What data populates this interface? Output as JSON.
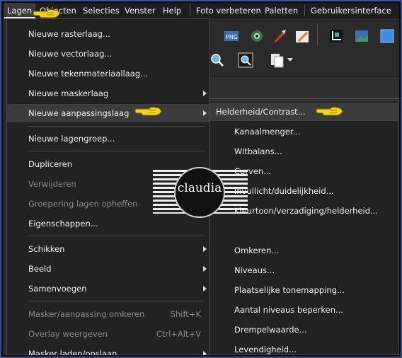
{
  "menubar": {
    "items": [
      "Lagen",
      "Objecten",
      "Selecties",
      "Venster",
      "Help",
      "Foto verbeteren",
      "Paletten",
      "Gebruikersinterface"
    ]
  },
  "layers_menu": {
    "items": [
      {
        "label": "Nieuwe rasterlaag...",
        "submenu": false
      },
      {
        "label": "Nieuwe vectorlaag...",
        "submenu": false
      },
      {
        "label": "Nieuwe tekenmateriaallaag...",
        "submenu": false
      },
      {
        "label": "Nieuwe maskerlaag",
        "submenu": true
      },
      {
        "label": "Nieuwe aanpassingslaag",
        "submenu": true,
        "highlighted": true
      },
      {
        "label": "Nieuwe lagengroep...",
        "submenu": false
      },
      {
        "label": "Dupliceren",
        "submenu": false
      },
      {
        "label": "Verwijderen",
        "disabled": true
      },
      {
        "label": "Groepering lagen opheffen",
        "disabled": true
      },
      {
        "label": "Eigenschappen...",
        "submenu": false
      },
      {
        "label": "Schikken",
        "submenu": true
      },
      {
        "label": "Beeld",
        "submenu": true
      },
      {
        "label": "Samenvoegen",
        "submenu": true
      },
      {
        "label": "Masker/aanpassing omkeren",
        "shortcut": "Shift+K",
        "disabled": true
      },
      {
        "label": "Overlay weergeven",
        "shortcut": "Ctrl+Alt+V",
        "disabled": true
      },
      {
        "label": "Masker laden/opslaan",
        "submenu": true
      }
    ]
  },
  "adjustment_submenu": {
    "items": [
      "Helderheid/Contrast...",
      "Kanaalmenger...",
      "Witbalans...",
      "Curven...",
      "Invullicht/duidelijkheid...",
      "Kleurtoon/verzadiging/helderheid...",
      "Omkeren...",
      "Niveaus...",
      "Plaatselijke tonemapping...",
      "Aantal niveaus beperken...",
      "Drempelwaarde...",
      "Levendigheid..."
    ]
  },
  "watermark": {
    "name": "claudia"
  },
  "colors": {
    "accent_frame": "#3a4f9a",
    "pointer_hand": "#f2d21a",
    "menu_bg": "#222222",
    "highlight": "#3c3c3c"
  }
}
